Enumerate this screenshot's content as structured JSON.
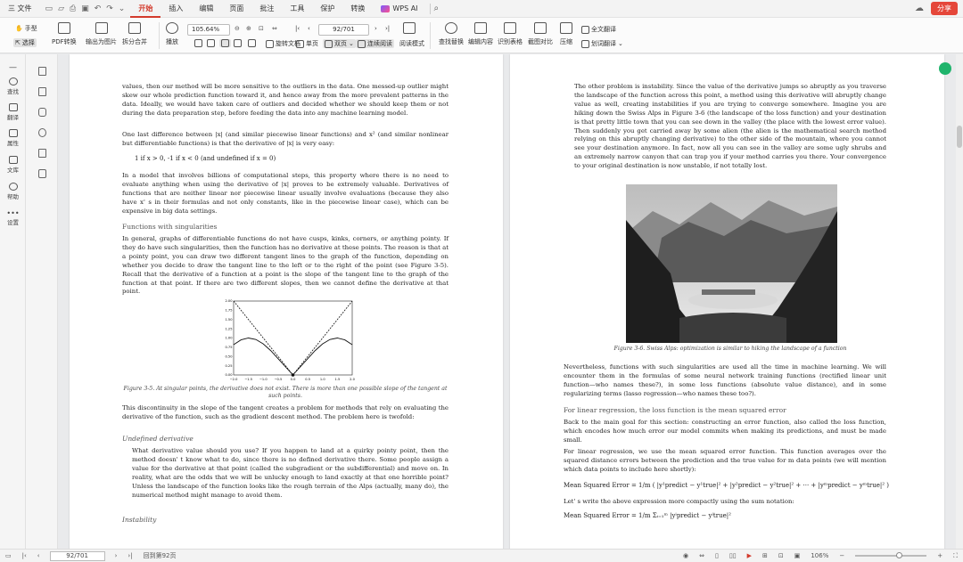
{
  "menubar": {
    "file": "三 文件",
    "tabs": [
      "开始",
      "插入",
      "编辑",
      "页面",
      "批注",
      "工具",
      "保护",
      "转换"
    ],
    "active_tab": "开始",
    "wps_ai": "WPS AI",
    "share": "分享"
  },
  "ribbon": {
    "hand": "手型",
    "select": "选择",
    "pdf_convert": "PDF转换",
    "export_image": "输出为图片",
    "split_merge": "拆分合并",
    "play": "播放",
    "zoom": "105.64%",
    "page_field": "92/701",
    "rotate": "旋转文档",
    "single": "单页",
    "double": "双页",
    "continuous": "连续阅读",
    "read_mode": "阅读模式",
    "find_replace": "查找替换",
    "edit_content": "编辑内容",
    "ocr_table": "识别表格",
    "compare": "截图对比",
    "compress": "压缩",
    "translate_full": "全文翻译",
    "translate_word": "划词翻译"
  },
  "sidebar": {
    "items": [
      "查找",
      "翻译",
      "属性",
      "文库",
      "帮助",
      "设置"
    ]
  },
  "left_page": {
    "p1": "values, then our method will be more sensitive to the outliers in the data. One messed-up outlier might skew our whole prediction function toward it, and hence away from the more prevalent patterns in the data. Ideally, we would have taken care of outliers and decided whether we should keep them or not during the data preparation step, before feeding the data into any machine learning model.",
    "p2": "One last difference between |x| (and similar piecewise linear functions) and x² (and similar nonlinear but differentiable functions) is that the derivative of |x| is very easy:",
    "formula1": "1 if x > 0,  -1 if x < 0 (and undefined if x = 0)",
    "p3": "In a model that involves billions of computational steps, this property where there is no need to evaluate anything when using the derivative of |x| proves to be extremely valuable. Derivatives of functions that are neither linear nor piecewise linear usually involve evaluations (because they also have x' s in their formulas and not only constants, like in the piecewise linear case), which can be expensive in big data settings.",
    "heading1": "Functions with singularities",
    "p4": "In general, graphs of differentiable functions do not have cusps, kinks, corners, or anything pointy. If they do have such singularities, then the function has no derivative at these points. The reason is that at a pointy point, you can draw two different tangent lines to the graph of the function, depending on whether you decide to draw the tangent line to the left or to the right of the point (see Figure 3-5). Recall that the derivative of a function at a point is the slope of the tangent line to the graph of the function at that point. If there are two different slopes, then we cannot define the derivative at that point.",
    "caption1": "Figure 3-5. At singular points, the derivative does not exist. There is more than one possible slope of the tangent at such points.",
    "p5": "This discontinuity in the slope of the tangent creates a problem for methods that rely on evaluating the derivative of the function, such as the gradient descent method. The problem here is twofold:",
    "heading2": "Undefined derivative",
    "p6": "What derivative value should you use? If you happen to land at a quirky pointy point, then the method doesn' t know what to do, since there is no defined derivative there. Some people assign a value for the derivative at that point (called the subgradient or the subdifferential) and move on. In reality, what are the odds that we will be unlucky enough to land exactly at that one horrible point? Unless the landscape of the function looks like the rough terrain of the Alps (actually, many do), the numerical method might manage to avoid them.",
    "heading3": "Instability"
  },
  "right_page": {
    "p1": "The other problem is instability. Since the value of the derivative jumps so abruptly as you traverse the landscape of the function across this point, a method using this derivative will abruptly change value as well, creating instabilities if you are trying to converge somewhere. Imagine you are hiking down the Swiss Alps in Figure 3-6 (the landscape of the loss function) and your destination is that pretty little town that you can see down in the valley (the place with the lowest error value). Then suddenly you get carried away by some alien (the alien is the mathematical search method relying on this abruptly changing derivative) to the other side of the mountain, where you cannot see your destination anymore. In fact, now all you can see in the valley are some ugly shrubs and an extremely narrow canyon that can trap you if your method carries you there. Your convergence to your original destination is now unstable, if not totally lost.",
    "caption2": "Figure 3-6. Swiss Alps: optimization is similar to hiking the landscape of a function",
    "p2": "Nevertheless, functions with such singularities are used all the time in machine learning. We will encounter them in the formulas of some neural network training functions (rectified linear unit function—who names these?), in some loss functions (absolute value distance), and in some regularizing terms (lasso regression—who names these too?).",
    "heading1": "For linear regression, the loss function is the mean squared error",
    "p3": "Back to the main goal for this section: constructing an error function, also called the loss function, which encodes how much error our model commits when making its predictions, and must be made small.",
    "p4": "For linear regression, we use the mean squared error function. This function averages over the squared distance errors between the prediction and the true value for m data points (we will mention which data points to include here shortly):",
    "formula1": "Mean Squared Error = 1/m ( |y¹predict − y¹true|² + |y²predict − y²true|² + ··· + |yᵐpredict − yᵐtrue|² )",
    "p5": "Let' s write the above expression more compactly using the sum notation:",
    "formula2": "Mean Squared Error = 1/m Σᵢ₌₁ᵐ |yⁱpredict − yⁱtrue|²"
  },
  "chart_data": {
    "type": "line",
    "title": "",
    "xlabel": "",
    "ylabel": "",
    "xlim": [
      -2.0,
      2.0
    ],
    "ylim": [
      0.0,
      2.0
    ],
    "xticks": [
      "−2.0",
      "−1.5",
      "−1.0",
      "−0.5",
      "0.0",
      "0.5",
      "1.0",
      "1.5",
      "2.0"
    ],
    "yticks": [
      "0.00",
      "0.25",
      "0.50",
      "0.75",
      "1.00",
      "1.25",
      "1.50",
      "1.75",
      "2.00"
    ],
    "series": [
      {
        "style": "solid",
        "x": [
          -2.0,
          -1.75,
          -1.5,
          -1.25,
          -1.0,
          -0.75,
          -0.5,
          -0.25,
          0.0,
          0.25,
          0.5,
          0.75,
          1.0,
          1.25,
          1.5,
          1.75,
          2.0
        ],
        "y": [
          0.82,
          0.95,
          1.0,
          0.96,
          0.84,
          0.66,
          0.44,
          0.22,
          0.0,
          0.22,
          0.44,
          0.66,
          0.84,
          0.96,
          1.0,
          0.95,
          0.82
        ]
      },
      {
        "style": "dashed",
        "x": [
          -2.0,
          -1.0,
          0.0,
          1.0,
          2.0
        ],
        "y": [
          2.0,
          1.0,
          0.0,
          1.0,
          2.0
        ]
      }
    ],
    "point": {
      "x": 0.0,
      "y": 0.0
    }
  },
  "status": {
    "page_field": "92/701",
    "back_to": "回到第92页",
    "zoom": "106%"
  }
}
